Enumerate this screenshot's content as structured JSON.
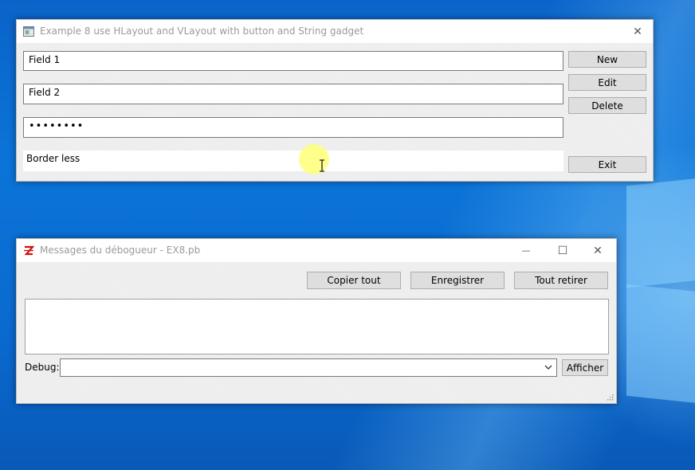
{
  "window1": {
    "title": "Example 8 use HLayout and VLayout with button and String gadget",
    "close_glyph": "✕",
    "fields": [
      {
        "value": "Field 1"
      },
      {
        "value": "Field 2"
      },
      {
        "value": "••••••••"
      },
      {
        "value": "Border less"
      }
    ],
    "buttons": {
      "new": "New",
      "edit": "Edit",
      "delete": "Delete",
      "exit": "Exit"
    }
  },
  "window2": {
    "title": "Messages du débogueur - EX8.pb",
    "minimize_glyph": "—",
    "maximize_glyph": "☐",
    "close_glyph": "✕",
    "buttons": {
      "copy_all": "Copier tout",
      "save": "Enregistrer",
      "clear_all": "Tout retirer",
      "show": "Afficher"
    },
    "debug_label": "Debug:",
    "debug_value": ""
  },
  "colors": {
    "desktop": "#0a6ad0",
    "window_bg": "#f0f0f0",
    "title_text": "#9a9a9a",
    "button_bg": "#e1e1e1",
    "cursor_highlight": "#ffff78"
  }
}
